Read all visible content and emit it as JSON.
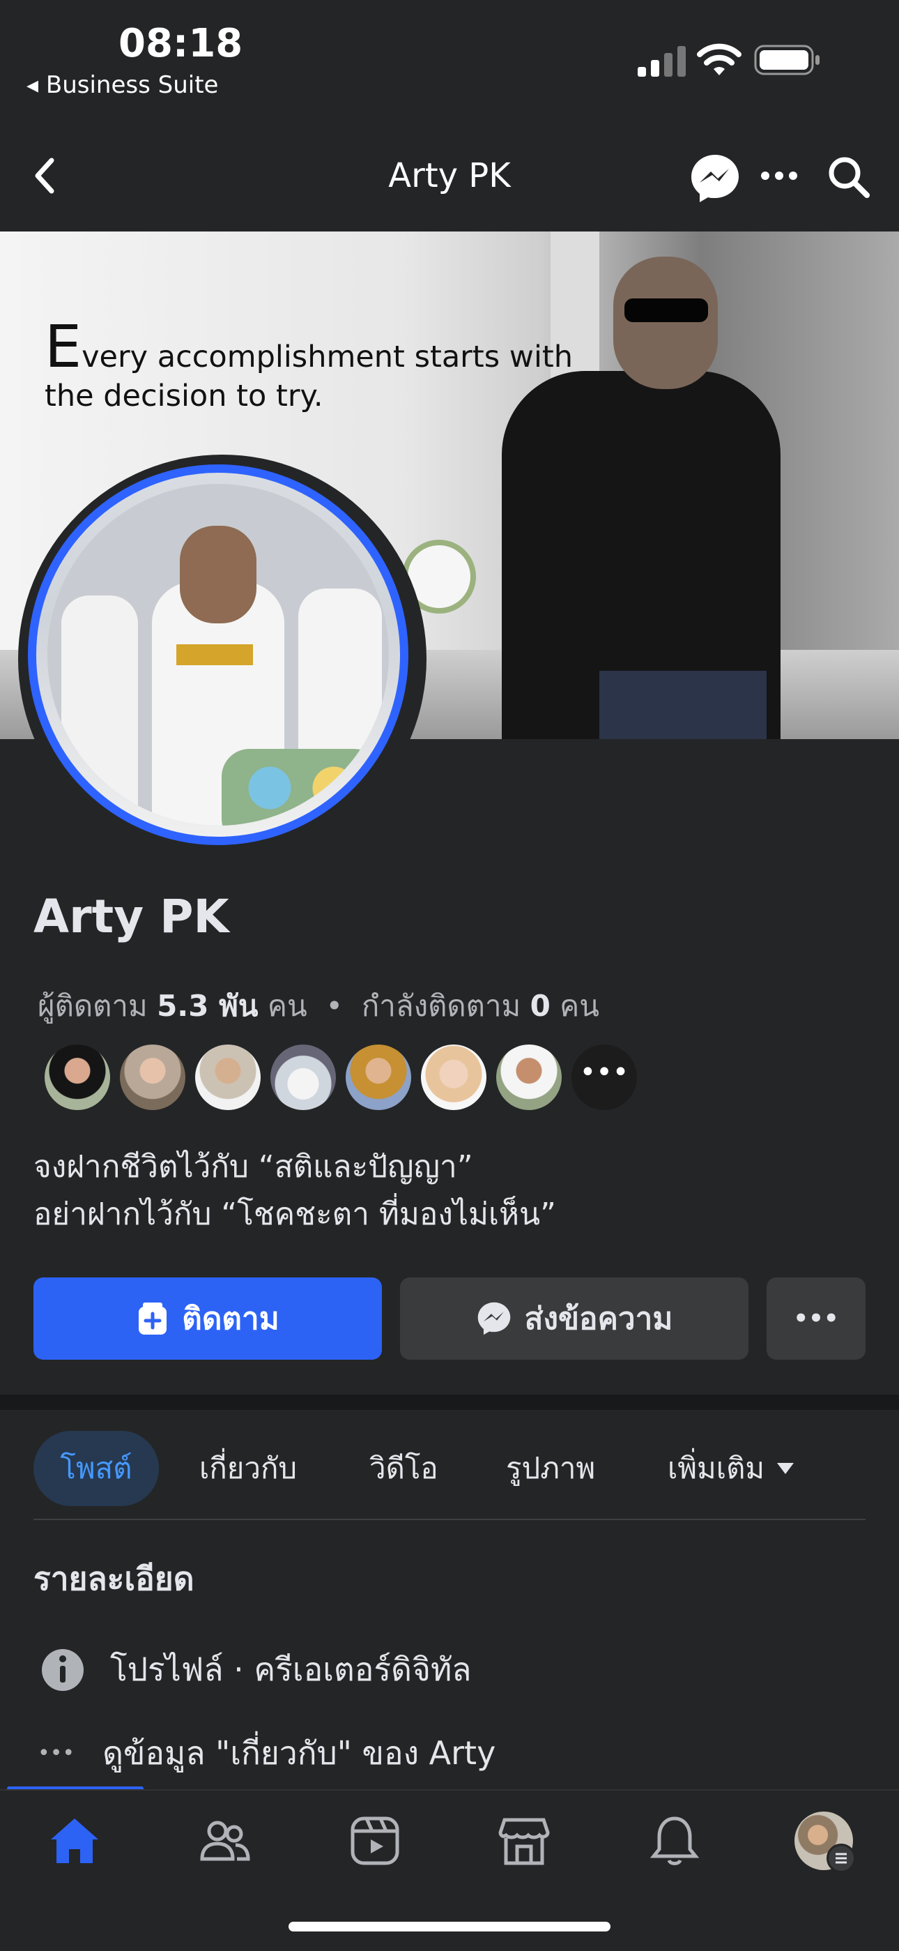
{
  "status_bar": {
    "time": "08:18",
    "back_app": "◂ Business Suite"
  },
  "nav": {
    "title": "Arty PK"
  },
  "cover": {
    "quote_first_letter": "E",
    "quote_rest_line1": "very accomplishment starts with",
    "quote_line2": "the decision to try."
  },
  "profile": {
    "name": "Arty PK",
    "followers_label": "ผู้ติดตาม",
    "followers_value": "5.3 พัน",
    "followers_unit": "คน",
    "separator": "•",
    "following_label": "กำลังติดตาม",
    "following_value": "0",
    "following_unit": "คน",
    "bio_line1": "จงฝากชีวิตไว้กับ “สติและปัญญา”",
    "bio_line2": "อย่าฝากไว้กับ “โชคชะตา ที่มองไม่เห็น”",
    "more_avatars_glyph": "•••"
  },
  "actions": {
    "follow_label": "ติดตาม",
    "message_label": "ส่งข้อความ",
    "more_label": "•••"
  },
  "tabs": [
    {
      "label": "โพสต์"
    },
    {
      "label": "เกี่ยวกับ"
    },
    {
      "label": "วิดีโอ"
    },
    {
      "label": "รูปภาพ"
    },
    {
      "label": "เพิ่มเติม"
    }
  ],
  "details": {
    "heading": "รายละเอียด",
    "row1": "โปรไฟล์ · ครีเอเตอร์ดิจิทัล",
    "row2": "ดูข้อมูล \"เกี่ยวกับ\" ของ Arty",
    "row2_icon_glyph": "•••"
  },
  "colors": {
    "accent": "#2d63f5",
    "background": "#242526",
    "surface": "#3a3b3c",
    "active_tab_bg": "#263951",
    "active_tab_text": "#4599ff"
  },
  "icons": {
    "nav": [
      "chevron-left-icon",
      "messenger-icon",
      "more-icon",
      "search-icon"
    ],
    "tabbar": [
      "home-icon",
      "friends-icon",
      "video-icon",
      "marketplace-icon",
      "bell-icon",
      "profile-avatar"
    ]
  }
}
